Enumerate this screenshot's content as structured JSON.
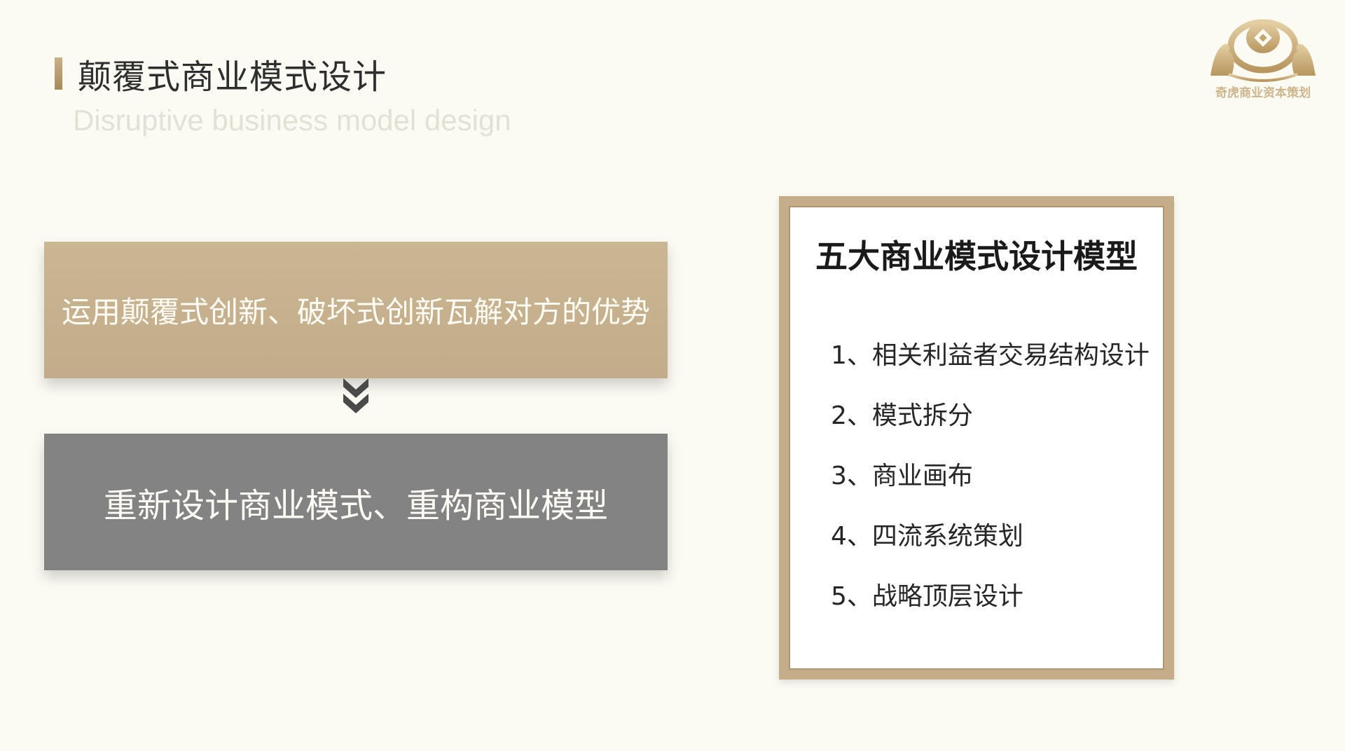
{
  "header": {
    "title": "颠覆式商业模式设计",
    "subtitle": "Disruptive business model design"
  },
  "flow": {
    "top_box": "运用颠覆式创新、破坏式创新瓦解对方的优势",
    "bottom_box": "重新设计商业模式、重构商业模型"
  },
  "model_panel": {
    "title": "五大商业模式设计模型",
    "items": [
      "1、相关利益者交易结构设计",
      "2、模式拆分",
      "3、商业画布",
      "4、四流系统策划",
      "5、战略顶层设计"
    ]
  },
  "logo": {
    "text": "奇虎商业资本策划",
    "icon": "lion-crest-logo"
  },
  "colors": {
    "background": "#fcfbf3",
    "accent_gold": "#c4ad88",
    "tan_box": "#c7b18e",
    "gray_box": "#838383"
  }
}
